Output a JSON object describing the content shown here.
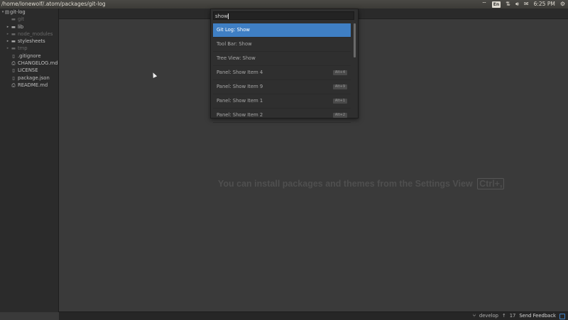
{
  "topbar": {
    "title": "/home/lonewolf/.atom/packages/git-log",
    "keyboard": "En",
    "time": "6:25 PM"
  },
  "tree": {
    "root": "git-log",
    "rows": [
      {
        "label": "git",
        "type": "folder",
        "dim": true,
        "chevron": "",
        "indent": 1
      },
      {
        "label": "lib",
        "type": "folder",
        "dim": false,
        "chevron": "▸",
        "indent": 1
      },
      {
        "label": "node_modules",
        "type": "folder",
        "dim": true,
        "chevron": "▸",
        "indent": 1
      },
      {
        "label": "stylesheets",
        "type": "folder",
        "dim": false,
        "chevron": "▸",
        "indent": 1
      },
      {
        "label": "tmp",
        "type": "folder",
        "dim": true,
        "chevron": "▸",
        "indent": 1
      },
      {
        "label": ".gitignore",
        "type": "file",
        "dim": false,
        "chevron": "",
        "indent": 1
      },
      {
        "label": "CHANGELOG.md",
        "type": "markdown",
        "dim": false,
        "chevron": "",
        "indent": 1
      },
      {
        "label": "LICENSE",
        "type": "file",
        "dim": false,
        "chevron": "",
        "indent": 1
      },
      {
        "label": "package.json",
        "type": "file",
        "dim": false,
        "chevron": "",
        "indent": 1
      },
      {
        "label": "README.md",
        "type": "markdown",
        "dim": false,
        "chevron": "",
        "indent": 1
      }
    ]
  },
  "palette": {
    "query": "show",
    "items": [
      {
        "label": "Git Log: Show",
        "key": "",
        "selected": true
      },
      {
        "label": "Tool Bar: Show",
        "key": "",
        "selected": false
      },
      {
        "label": "Tree View: Show",
        "key": "",
        "selected": false
      },
      {
        "label": "Panel: Show Item 4",
        "key": "Alt+4",
        "selected": false
      },
      {
        "label": "Panel: Show Item 9",
        "key": "Alt+9",
        "selected": false
      },
      {
        "label": "Panel: Show Item 1",
        "key": "Alt+1",
        "selected": false
      },
      {
        "label": "Panel: Show Item 2",
        "key": "Alt+2",
        "selected": false
      }
    ]
  },
  "welcome": {
    "text": "You can install packages and themes from the Settings View",
    "shortcut": "Ctrl+,"
  },
  "statusbar": {
    "branch": "develop",
    "count": "17",
    "feedback": "Send Feedback"
  }
}
